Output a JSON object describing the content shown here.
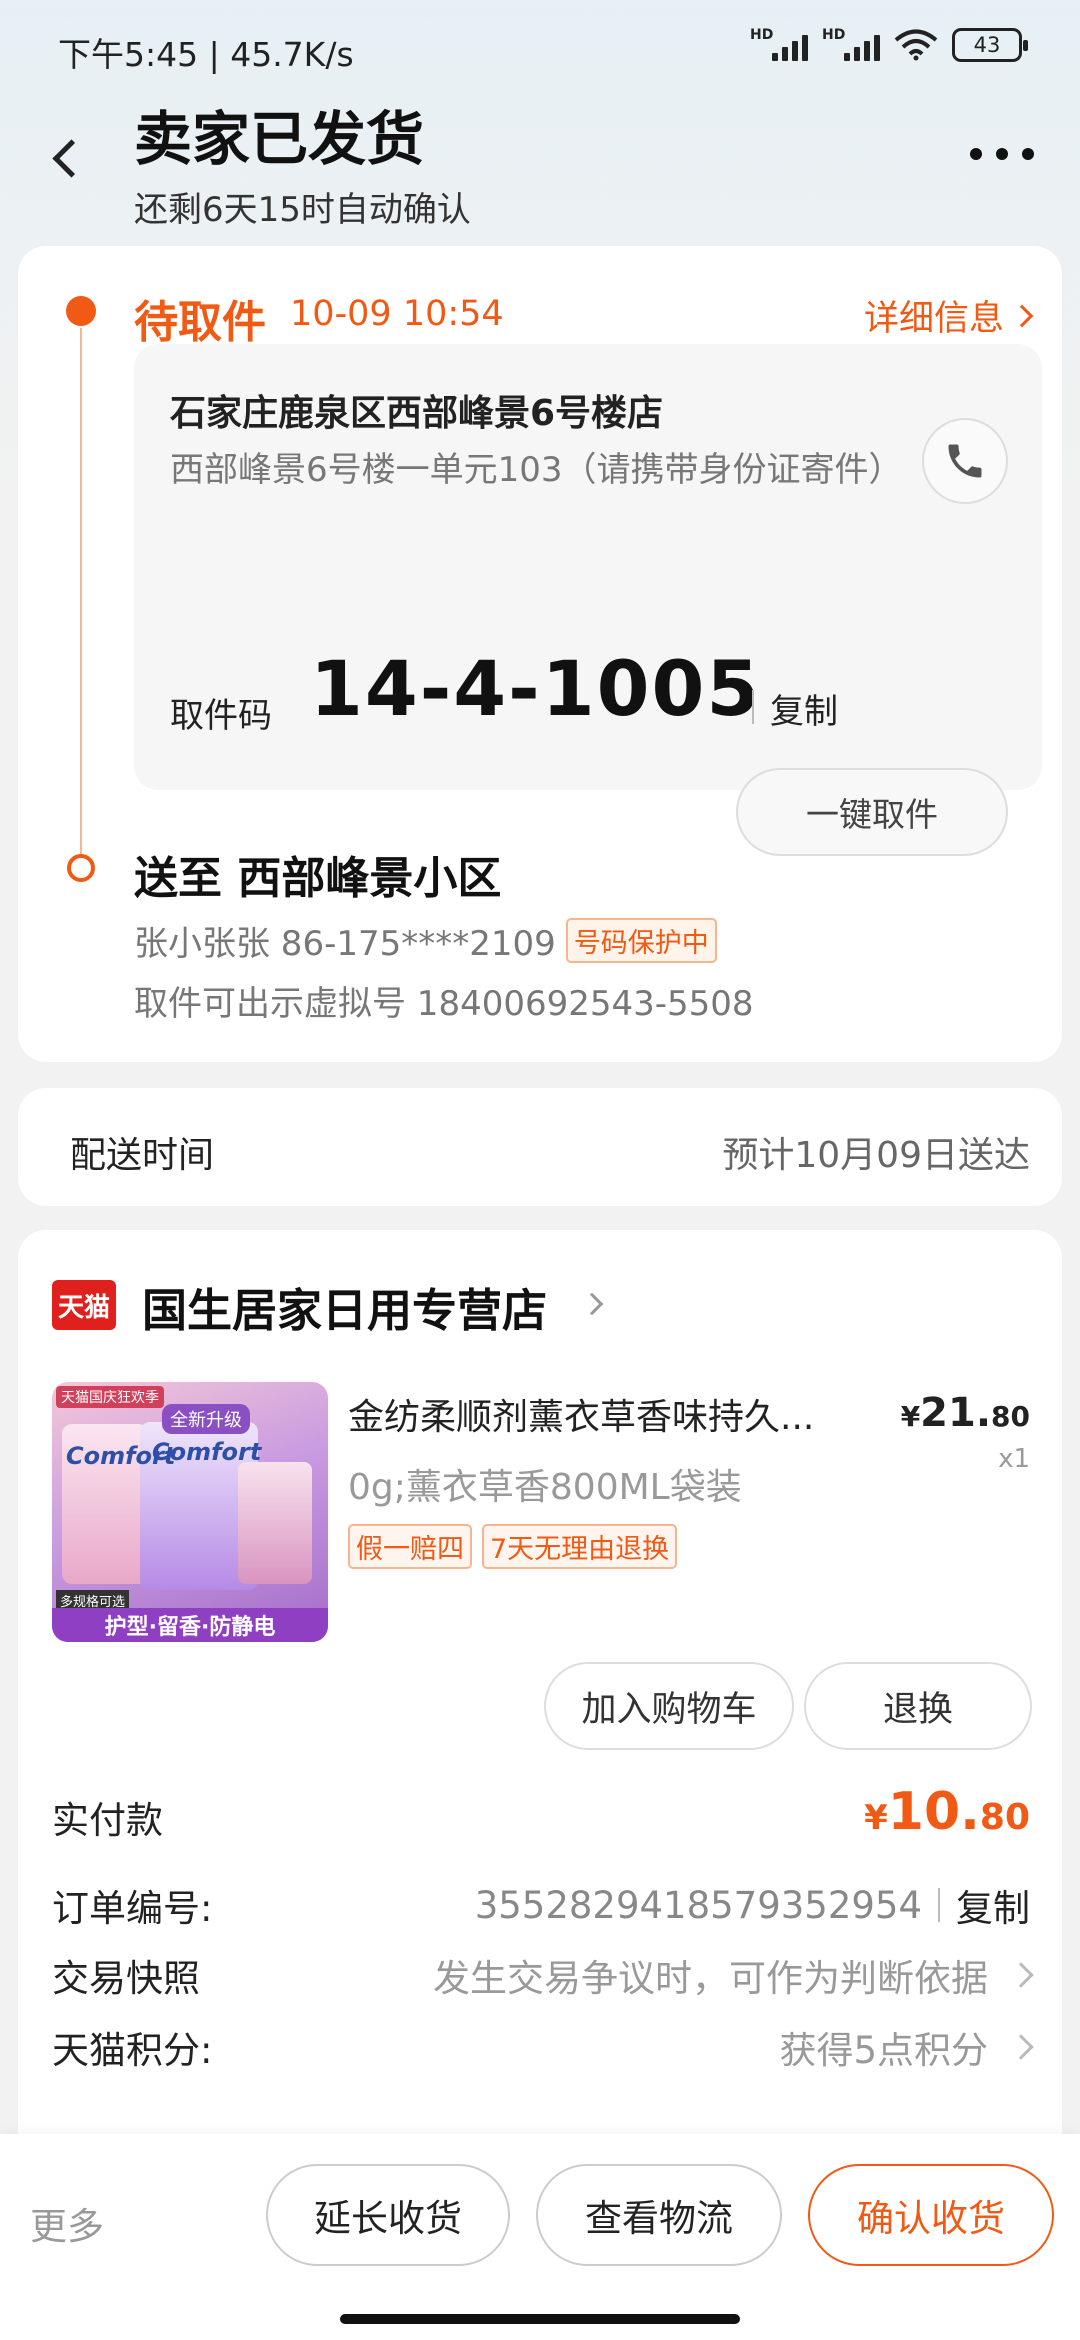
{
  "status_bar": {
    "time_speed": "下午5:45 | 45.7K/s",
    "battery": "43",
    "hd1": "HD",
    "hd2": "HD"
  },
  "header": {
    "title": "卖家已发货",
    "subtitle": "还剩6天15时自动确认"
  },
  "pickup": {
    "status": "待取件",
    "time": "10-09 10:54",
    "detail_link": "详细信息",
    "store_name": "石家庄鹿泉区西部峰景6号楼店",
    "store_address": "西部峰景6号楼一单元103（请携带身份证寄件）",
    "code_label": "取件码",
    "code": "14-4-1005",
    "copy": "复制",
    "onekey": "一键取件"
  },
  "destination": {
    "title": "送至 西部峰景小区",
    "contact": "张小张张 86-175****2109",
    "protect_badge": "号码保护中",
    "virtual": "取件可出示虚拟号 18400692543-5508"
  },
  "delivery": {
    "label": "配送时间",
    "value": "预计10月09日送达"
  },
  "store": {
    "logo": "天猫",
    "name": "国生居家日用专营店"
  },
  "product": {
    "image_texts": {
      "top_tag": "天猫国庆狂欢季",
      "new_tag": "全新升级",
      "brand": "Comfort",
      "multi": "多规格可选",
      "banner": "护型·留香·防静电"
    },
    "title": "金纺柔顺剂薰衣草香味持久...",
    "spec": "0g;薰衣草香800ML袋装",
    "price_symbol": "¥",
    "price_int": "21.",
    "price_dec": "80",
    "quantity": "x1",
    "tags": [
      "假一赔四",
      "7天无理由退换"
    ],
    "add_cart": "加入购物车",
    "return": "退换"
  },
  "order": {
    "paid_label": "实付款",
    "paid_symbol": "¥",
    "paid_int": "10.",
    "paid_dec": "80",
    "order_no_label": "订单编号:",
    "order_no": "3552829418579352954",
    "order_copy": "复制",
    "snapshot_label": "交易快照",
    "snapshot_value": "发生交易争议时，可作为判断依据",
    "points_label": "天猫积分:",
    "points_value": "获得5点积分"
  },
  "bottom": {
    "more": "更多",
    "extend": "延长收货",
    "logistics": "查看物流",
    "confirm": "确认收货"
  },
  "colors": {
    "accent": "#f05a14",
    "tmall_red": "#e0201c"
  }
}
